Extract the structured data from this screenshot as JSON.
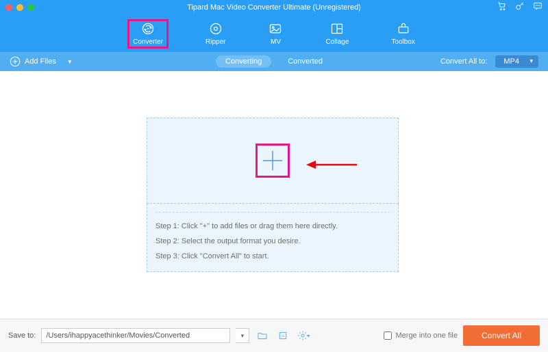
{
  "title": "Tipard Mac Video Converter Ultimate (Unregistered)",
  "nav": {
    "items": [
      {
        "label": "Converter"
      },
      {
        "label": "Ripper"
      },
      {
        "label": "MV"
      },
      {
        "label": "Collage"
      },
      {
        "label": "Toolbox"
      }
    ]
  },
  "toolbar": {
    "add_files": "Add Files",
    "segments": {
      "converting": "Converting",
      "converted": "Converted"
    },
    "convert_all_to": "Convert All to:",
    "format": "MP4"
  },
  "steps": {
    "s1": "Step 1: Click \"+\" to add files or drag them here directly.",
    "s2": "Step 2: Select the output format you desire.",
    "s3": "Step 3: Click \"Convert All\" to start."
  },
  "footer": {
    "save_to": "Save to:",
    "path": "/Users/ihappyacethinker/Movies/Converted",
    "merge": "Merge into one file",
    "convert_all": "Convert All"
  }
}
